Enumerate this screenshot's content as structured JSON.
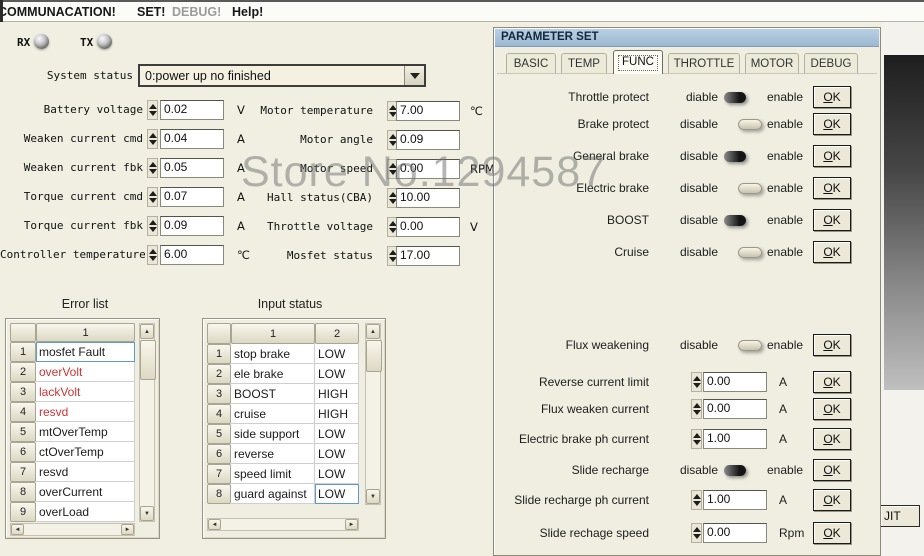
{
  "menu": {
    "items": [
      {
        "label": "COMMUNACATION!"
      },
      {
        "label": "SET!"
      },
      {
        "label": "DEBUG!",
        "disabled": true
      },
      {
        "label": "Help!"
      }
    ]
  },
  "comm": {
    "rx": "RX",
    "tx": "TX"
  },
  "status": {
    "system_label": "System status",
    "system_value": "0:power up no finished",
    "left": [
      {
        "label": "Battery voltage",
        "value": "0.02",
        "unit": "V"
      },
      {
        "label": "Weaken current cmd",
        "value": "0.04",
        "unit": "A"
      },
      {
        "label": "Weaken current fbk",
        "value": "0.05",
        "unit": "A"
      },
      {
        "label": "Torque current cmd",
        "value": "0.07",
        "unit": "A"
      },
      {
        "label": "Torque current fbk",
        "value": "0.09",
        "unit": "A"
      },
      {
        "label": "Controller temperature",
        "value": "6.00",
        "unit": "℃"
      }
    ],
    "right": [
      {
        "label": "Motor temperature",
        "value": "7.00",
        "unit": "℃"
      },
      {
        "label": "Motor angle",
        "value": "0.09",
        "unit": ""
      },
      {
        "label": "Motor speed",
        "value": "0.00",
        "unit": "RPM"
      },
      {
        "label": "Hall status(CBA)",
        "value": "10.00",
        "unit": ""
      },
      {
        "label": "Throttle voltage",
        "value": "0.00",
        "unit": "V"
      },
      {
        "label": "Mosfet status",
        "value": "17.00",
        "unit": ""
      }
    ]
  },
  "error_list": {
    "title": "Error list",
    "header": "1",
    "rows": [
      {
        "num": "1",
        "text": "mosfet Fault",
        "color": "black",
        "selected": true
      },
      {
        "num": "2",
        "text": "overVolt",
        "color": "red"
      },
      {
        "num": "3",
        "text": "lackVolt",
        "color": "red"
      },
      {
        "num": "4",
        "text": "resvd",
        "color": "red"
      },
      {
        "num": "5",
        "text": "mtOverTemp",
        "color": "black"
      },
      {
        "num": "6",
        "text": "ctOverTemp",
        "color": "black"
      },
      {
        "num": "7",
        "text": "resvd",
        "color": "black"
      },
      {
        "num": "8",
        "text": "overCurrent",
        "color": "black"
      },
      {
        "num": "9",
        "text": "overLoad",
        "color": "black"
      }
    ]
  },
  "input_status": {
    "title": "Input status",
    "headers": [
      "1",
      "2"
    ],
    "rows": [
      {
        "num": "1",
        "name": "stop brake",
        "state": "LOW"
      },
      {
        "num": "2",
        "name": "ele brake",
        "state": "LOW"
      },
      {
        "num": "3",
        "name": "BOOST",
        "state": "HIGH"
      },
      {
        "num": "4",
        "name": "cruise",
        "state": "HIGH"
      },
      {
        "num": "5",
        "name": "side support",
        "state": "LOW"
      },
      {
        "num": "6",
        "name": "reverse",
        "state": "LOW"
      },
      {
        "num": "7",
        "name": "speed limit",
        "state": "LOW"
      },
      {
        "num": "8",
        "name": "guard against",
        "state": "LOW",
        "selected": true
      }
    ]
  },
  "dialog": {
    "title": "PARAMETER SET",
    "tabs": [
      {
        "label": "BASIC"
      },
      {
        "label": "TEMP"
      },
      {
        "label": "FUNC",
        "active": true
      },
      {
        "label": "THROTTLE"
      },
      {
        "label": "MOTOR"
      },
      {
        "label": "DEBUG"
      }
    ],
    "active_tab": "FUNC",
    "ok_label": "OK",
    "rows": [
      {
        "type": "toggle",
        "label": "Throttle protect",
        "off": "diable",
        "on": "enable",
        "state": "disable"
      },
      {
        "type": "toggle",
        "label": "Brake protect",
        "off": "disable",
        "on": "enable",
        "state": "enable"
      },
      {
        "type": "toggle",
        "label": "General brake",
        "off": "disable",
        "on": "enable",
        "state": "disable"
      },
      {
        "type": "toggle",
        "label": "Electric brake",
        "off": "disable",
        "on": "enable",
        "state": "enable"
      },
      {
        "type": "toggle",
        "label": "BOOST",
        "off": "disable",
        "on": "enable",
        "state": "disable"
      },
      {
        "type": "toggle",
        "label": "Cruise",
        "off": "disable",
        "on": "enable",
        "state": "enable"
      },
      {
        "type": "toggle",
        "label": "Flux weakening",
        "off": "disable",
        "on": "enable",
        "state": "enable"
      },
      {
        "type": "numeric",
        "label": "Reverse current limit",
        "value": "0.00",
        "unit": "A"
      },
      {
        "type": "numeric",
        "label": "Flux weaken current",
        "value": "0.00",
        "unit": "A"
      },
      {
        "type": "numeric",
        "label": "Electric brake ph current",
        "value": "1.00",
        "unit": "A"
      },
      {
        "type": "toggle",
        "label": "Slide recharge",
        "off": "disable",
        "on": "enable",
        "state": "disable"
      },
      {
        "type": "numeric",
        "label": "Slide recharge ph current",
        "value": "1.00",
        "unit": "A"
      },
      {
        "type": "numeric",
        "label": "Slide rechage speed",
        "value": "0.00",
        "unit": "Rpm"
      }
    ]
  },
  "quit": {
    "label": "JIT"
  },
  "watermark": {
    "text": "Store No.1294587"
  },
  "colors": {
    "titlebar": "#a9c3da",
    "dialog_bg": "#f0eee1",
    "error_red": "#ce3434",
    "selection_blue": "#5f9bcb"
  }
}
